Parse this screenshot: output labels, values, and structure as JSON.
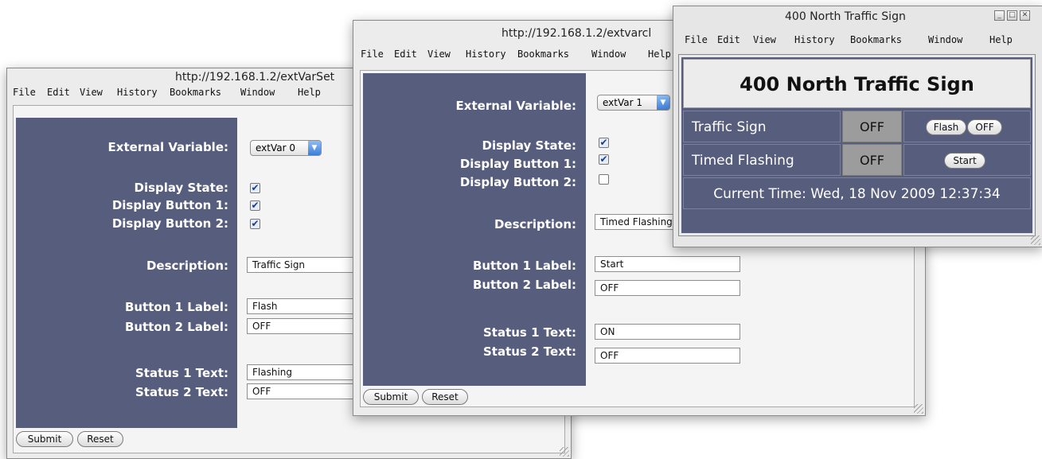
{
  "browser_menu": [
    "File",
    "Edit",
    "View",
    "History",
    "Bookmarks",
    "Window",
    "Help"
  ],
  "window_a": {
    "title": "http://192.168.1.2/extVarSet",
    "fields": {
      "ext_var_label": "External Variable:",
      "ext_var_value": "extVar 0",
      "display_state_label": "Display State:",
      "display_state_checked": true,
      "display_button1_label": "Display Button 1:",
      "display_button1_checked": true,
      "display_button2_label": "Display Button 2:",
      "display_button2_checked": true,
      "description_label": "Description:",
      "description_value": "Traffic Sign",
      "button1_label_label": "Button 1 Label:",
      "button1_label_value": "Flash",
      "button2_label_label": "Button 2 Label:",
      "button2_label_value": "OFF",
      "status1_label": "Status 1 Text:",
      "status1_value": "Flashing",
      "status2_label": "Status 2 Text:",
      "status2_value": "OFF"
    },
    "submit": "Submit",
    "reset": "Reset"
  },
  "window_b": {
    "title": "http://192.168.1.2/extvarcl",
    "menu_help_truncated": "Help",
    "fields": {
      "ext_var_label": "External Variable:",
      "ext_var_value": "extVar 1",
      "display_state_label": "Display State:",
      "display_state_checked": true,
      "display_button1_label": "Display Button 1:",
      "display_button1_checked": true,
      "display_button2_label": "Display Button 2:",
      "display_button2_checked": false,
      "description_label": "Description:",
      "description_value": "Timed Flashing",
      "button1_label_label": "Button 1 Label:",
      "button1_label_value": "Start",
      "button2_label_label": "Button 2 Label:",
      "button2_label_value": "OFF",
      "status1_label": "Status 1 Text:",
      "status1_value": "ON",
      "status2_label": "Status 2 Text:",
      "status2_value": "OFF"
    },
    "submit": "Submit",
    "reset": "Reset"
  },
  "window_c": {
    "title": "400 North Traffic Sign",
    "heading": "400 North Traffic Sign",
    "rows": [
      {
        "name": "Traffic Sign",
        "status": "OFF",
        "buttons": [
          "Flash",
          "OFF"
        ]
      },
      {
        "name": "Timed Flashing",
        "status": "OFF",
        "buttons": [
          "Start"
        ]
      }
    ],
    "current_time": "Current Time: Wed, 18 Nov 2009 12:37:34"
  },
  "colors": {
    "panel": "#575d7c",
    "status_cell": "#9c9c9c",
    "content_bg": "#f4f4f4"
  }
}
